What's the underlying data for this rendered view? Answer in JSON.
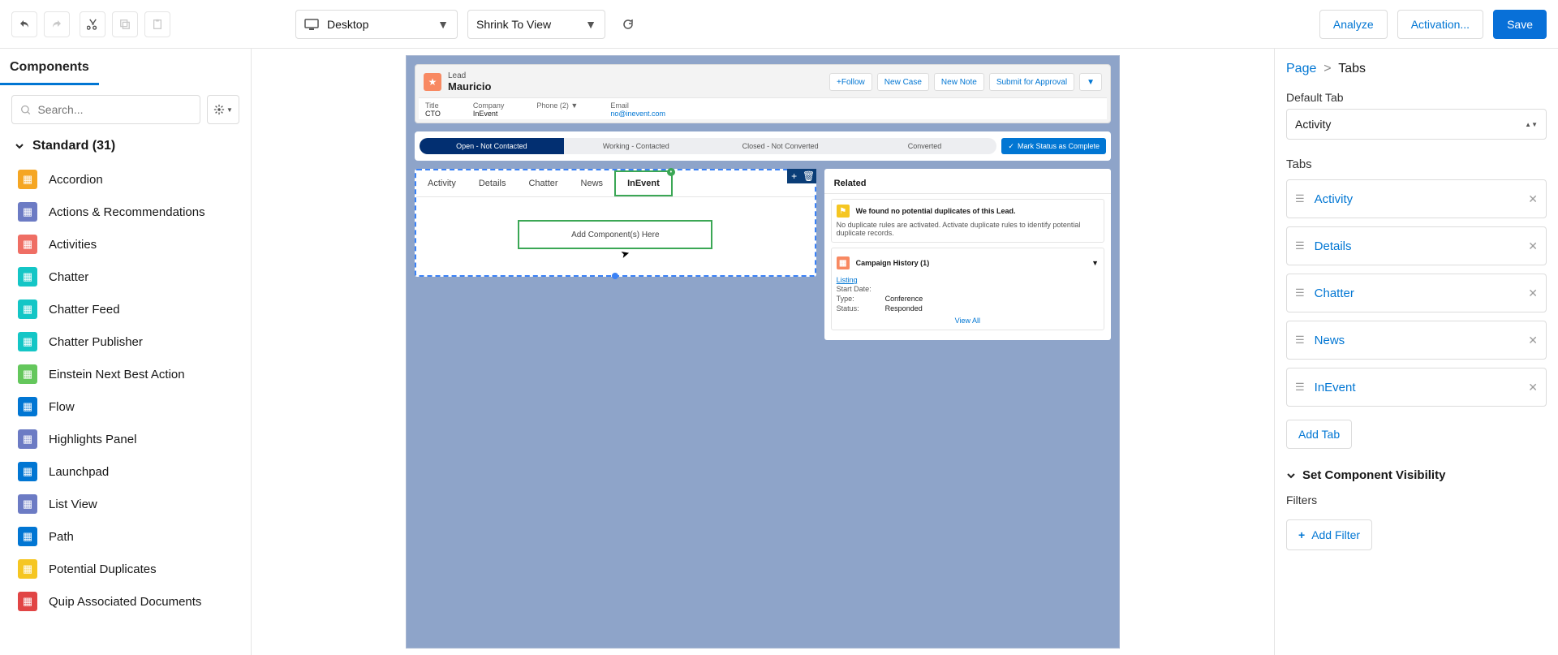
{
  "topbar": {
    "device": "Desktop",
    "zoom": "Shrink To View",
    "analyze": "Analyze",
    "activation": "Activation...",
    "save": "Save"
  },
  "left": {
    "tab": "Components",
    "search_placeholder": "Search...",
    "section": "Standard (31)",
    "items": [
      {
        "label": "Accordion",
        "color": "#F5A623"
      },
      {
        "label": "Actions & Recommendations",
        "color": "#6C7BC4"
      },
      {
        "label": "Activities",
        "color": "#EF6E64"
      },
      {
        "label": "Chatter",
        "color": "#14C6C6"
      },
      {
        "label": "Chatter Feed",
        "color": "#14C6C6"
      },
      {
        "label": "Chatter Publisher",
        "color": "#14C6C6"
      },
      {
        "label": "Einstein Next Best Action",
        "color": "#64C75C"
      },
      {
        "label": "Flow",
        "color": "#0176D3"
      },
      {
        "label": "Highlights Panel",
        "color": "#6C7BC4"
      },
      {
        "label": "Launchpad",
        "color": "#0176D3"
      },
      {
        "label": "List View",
        "color": "#6C7BC4"
      },
      {
        "label": "Path",
        "color": "#0176D3"
      },
      {
        "label": "Potential Duplicates",
        "color": "#F5C622"
      },
      {
        "label": "Quip Associated Documents",
        "color": "#E14545"
      }
    ]
  },
  "record": {
    "obj": "Lead",
    "name": "Mauricio",
    "follow": "Follow",
    "btns": [
      "New Case",
      "New Note",
      "Submit for Approval"
    ],
    "fields": {
      "title_lbl": "Title",
      "title_val": "CTO",
      "company_lbl": "Company",
      "company_val": "InEvent",
      "phone_lbl": "Phone (2)",
      "email_lbl": "Email",
      "email_val": "no@inevent.com"
    }
  },
  "path": {
    "steps": [
      "Open - Not Contacted",
      "Working - Contacted",
      "Closed - Not Converted",
      "Converted"
    ],
    "complete": "Mark Status as Complete"
  },
  "tabs_canvas": {
    "tabs": [
      "Activity",
      "Details",
      "Chatter",
      "News",
      "InEvent"
    ],
    "selected": "InEvent",
    "drop": "Add Component(s) Here"
  },
  "related": {
    "title": "Related",
    "dup_head": "We found no potential duplicates of this Lead.",
    "dup_body": "No duplicate rules are activated. Activate duplicate rules to identify potential duplicate records.",
    "camp_title": "Campaign History (1)",
    "listing": "Listing",
    "rows": [
      {
        "k": "Start Date:",
        "v": ""
      },
      {
        "k": "Type:",
        "v": "Conference"
      },
      {
        "k": "Status:",
        "v": "Responded"
      }
    ],
    "viewall": "View All"
  },
  "insp": {
    "crumb_page": "Page",
    "crumb_current": "Tabs",
    "default_lbl": "Default Tab",
    "default_val": "Activity",
    "tabs_lbl": "Tabs",
    "tabs": [
      "Activity",
      "Details",
      "Chatter",
      "News",
      "InEvent"
    ],
    "addtab": "Add Tab",
    "vis": "Set Component Visibility",
    "filters_lbl": "Filters",
    "addfilter": "Add Filter"
  }
}
